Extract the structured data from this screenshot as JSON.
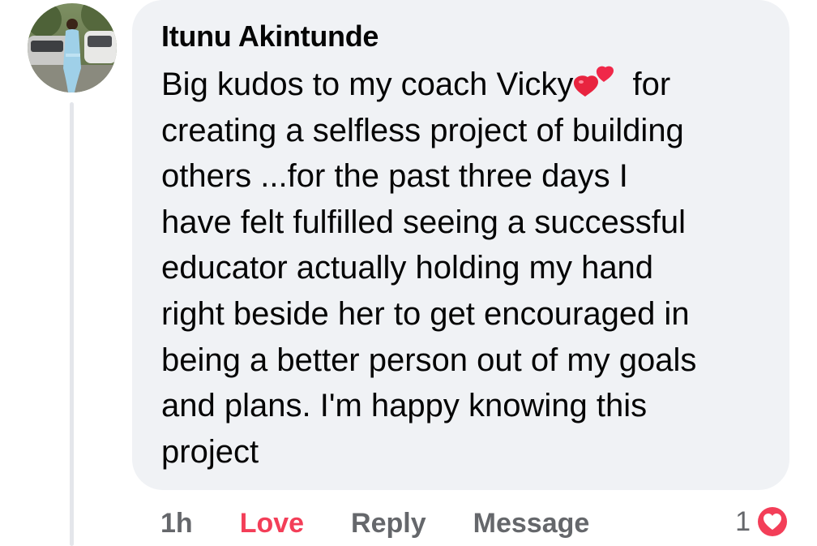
{
  "comment": {
    "author": "Itunu Akintunde",
    "lines": [
      "Big kudos to my coach Vicky",
      " for",
      "creating a selfless project of building",
      "others ...for the past three days I",
      "have felt fulfilled seeing a successful",
      "educator actually holding my hand",
      "right beside her to get encouraged in",
      "being a better person out of my goals",
      "and plans. I'm happy knowing this",
      "project"
    ],
    "emoji": "two-hearts-icon"
  },
  "actions": {
    "time": "1h",
    "love_label": "Love",
    "reply_label": "Reply",
    "message_label": "Message"
  },
  "reactions": {
    "count": "1",
    "icon": "love-reaction-icon"
  },
  "colors": {
    "bubble": "#f0f2f5",
    "text": "#050505",
    "muted": "#65676b",
    "love": "#f33e58",
    "thread_line": "#e4e6eb"
  }
}
